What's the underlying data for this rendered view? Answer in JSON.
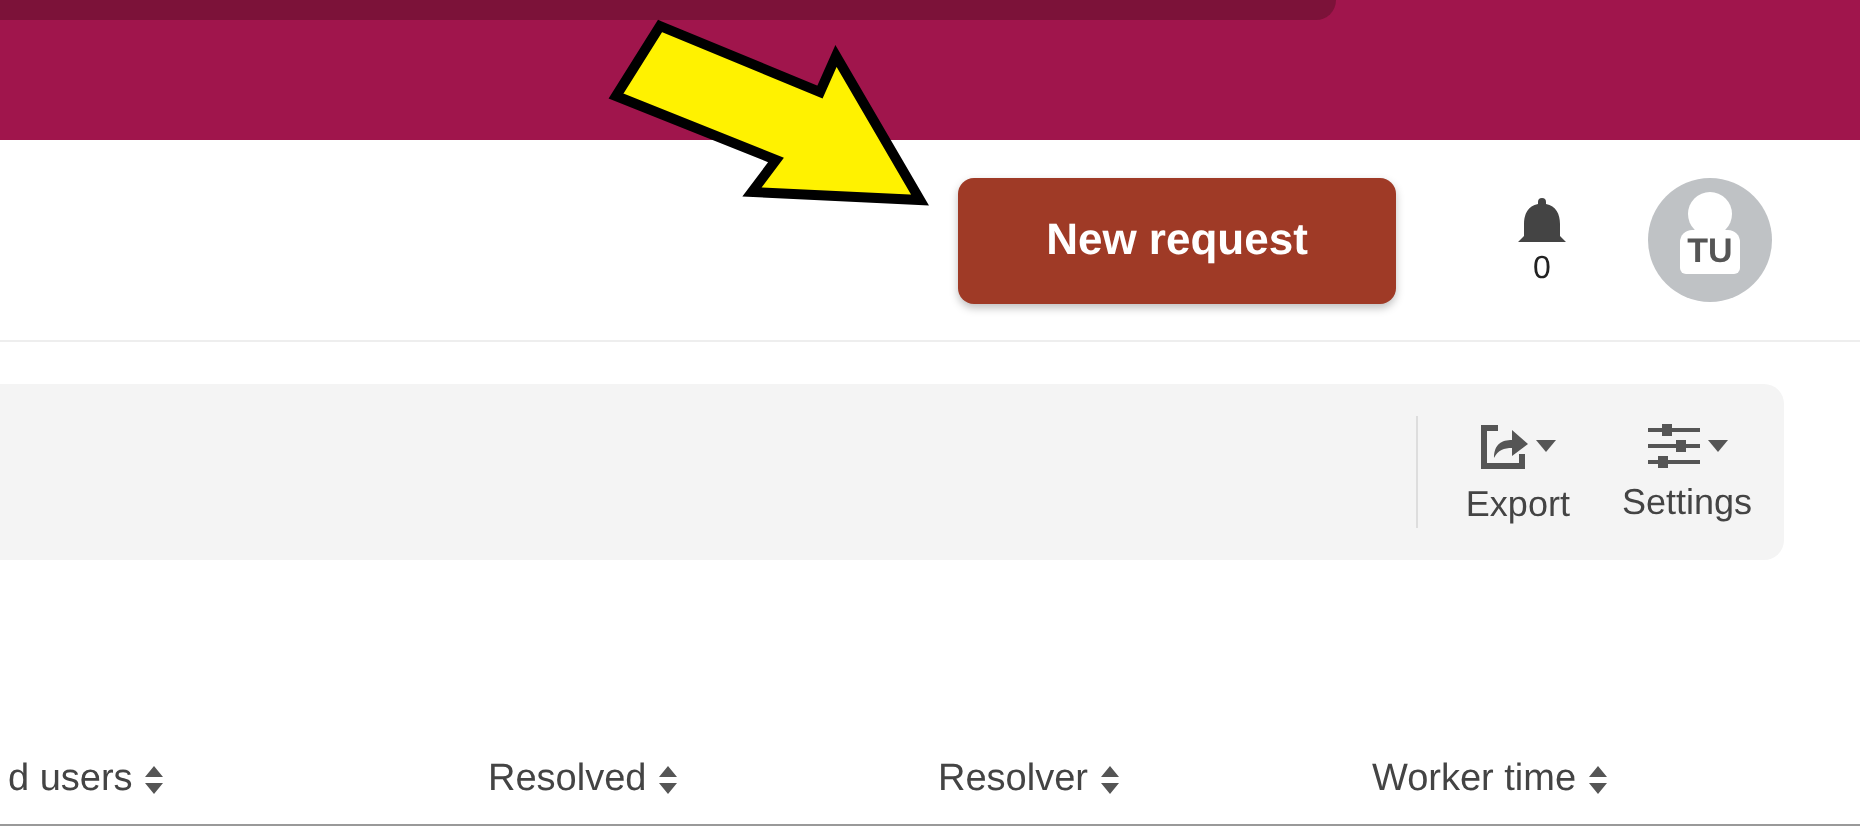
{
  "header": {
    "new_request_button": "New request",
    "notifications": {
      "count": "0"
    },
    "avatar": {
      "initials": "TU"
    }
  },
  "toolbar": {
    "actions": [
      {
        "label": "Export",
        "kind": "export"
      },
      {
        "label": "Settings",
        "kind": "settings"
      }
    ]
  },
  "table": {
    "columns": [
      {
        "label": "d users"
      },
      {
        "label": "Resolved"
      },
      {
        "label": "Resolver"
      },
      {
        "label": "Worker time"
      }
    ]
  }
}
